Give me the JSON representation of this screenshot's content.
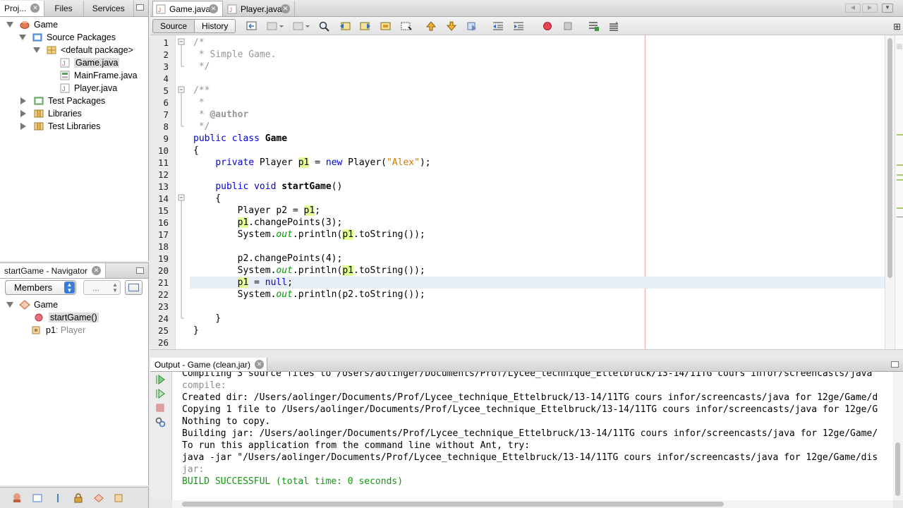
{
  "left_tabs": [
    "Proj...",
    "Files",
    "Services"
  ],
  "project_tree": [
    {
      "label": "Game",
      "depth": 0,
      "expanded": true,
      "icon": "project-icon"
    },
    {
      "label": "Source Packages",
      "depth": 1,
      "expanded": true,
      "icon": "source-packages-icon"
    },
    {
      "label": "<default package>",
      "depth": 2,
      "expanded": true,
      "icon": "package-icon"
    },
    {
      "label": "Game.java",
      "depth": 3,
      "icon": "java-file-icon",
      "selected": true
    },
    {
      "label": "MainFrame.java",
      "depth": 3,
      "icon": "form-file-icon"
    },
    {
      "label": "Player.java",
      "depth": 3,
      "icon": "java-file-icon"
    },
    {
      "label": "Test Packages",
      "depth": 1,
      "expanded": false,
      "icon": "test-packages-icon"
    },
    {
      "label": "Libraries",
      "depth": 1,
      "expanded": false,
      "icon": "libraries-icon"
    },
    {
      "label": "Test Libraries",
      "depth": 1,
      "expanded": false,
      "icon": "test-libraries-icon"
    }
  ],
  "navigator": {
    "title": "startGame - Navigator",
    "filter": "Members",
    "filter2": "...",
    "root": "Game",
    "members": [
      {
        "name": "startGame()",
        "type": "",
        "icon": "method-icon",
        "selected": true
      },
      {
        "name": "p1",
        "type": " : Player",
        "icon": "field-icon"
      }
    ]
  },
  "editor": {
    "tabs": [
      "Game.java",
      "Player.java"
    ],
    "source_label": "Source",
    "history_label": "History",
    "current_line": 21,
    "lines": [
      {
        "n": "1",
        "html": "<span class='cm'>/*</span>"
      },
      {
        "n": "2",
        "html": "<span class='cm'> * Simple Game.</span>"
      },
      {
        "n": "3",
        "html": "<span class='cm'> */</span>"
      },
      {
        "n": "4",
        "html": ""
      },
      {
        "n": "5",
        "html": "<span class='cm'>/**</span>"
      },
      {
        "n": "6",
        "html": "<span class='cm'> *</span>"
      },
      {
        "n": "7",
        "html": "<span class='cm'> * <b>@author</b></span>"
      },
      {
        "n": "8",
        "html": "<span class='cm'> */</span>"
      },
      {
        "n": "9",
        "html": "<span class='kw'>public class</span> <span class='bold'>Game</span>"
      },
      {
        "n": "10",
        "html": "{"
      },
      {
        "n": "11",
        "html": "    <span class='kw'>private</span> Player <span class='hl'>p1</span> = <span class='kw'>new</span> Player(<span class='st'>\"Alex\"</span>);"
      },
      {
        "n": "12",
        "html": ""
      },
      {
        "n": "13",
        "html": "    <span class='kw'>public void</span> <span class='bold'>startGame</span>()"
      },
      {
        "n": "14",
        "html": "    {"
      },
      {
        "n": "15",
        "html": "        Player p2 = <span class='hl'>p1</span>;"
      },
      {
        "n": "16",
        "html": "        <span class='hl'>p1</span>.changePoints(3);"
      },
      {
        "n": "17",
        "html": "        System.<span class='it'>out</span>.println(<span class='hl'>p1</span>.toString());"
      },
      {
        "n": "18",
        "html": ""
      },
      {
        "n": "19",
        "html": "        p2.changePoints(4);"
      },
      {
        "n": "20",
        "html": "        System.<span class='it'>out</span>.println(<span class='hl'>p1</span>.toString());"
      },
      {
        "n": "21",
        "html": "        <span class='hl'>p1</span> = <span class='kw'>null</span>;"
      },
      {
        "n": "22",
        "html": "        System.<span class='it'>out</span>.println(p2.toString());"
      },
      {
        "n": "23",
        "html": ""
      },
      {
        "n": "24",
        "html": "    }"
      },
      {
        "n": "25",
        "html": "}"
      },
      {
        "n": "26",
        "html": ""
      }
    ]
  },
  "output": {
    "title": "Output - Game (clean,jar)",
    "lines": [
      {
        "text": "Compiling 3 source files to /Users/aolinger/Documents/Prof/Lycee_technique_Ettelbruck/13-14/11TG cours infor/screencasts/java",
        "color": "#000"
      },
      {
        "text": "compile:",
        "color": "#8c8c8c"
      },
      {
        "text": "Created dir: /Users/aolinger/Documents/Prof/Lycee_technique_Ettelbruck/13-14/11TG cours infor/screencasts/java for 12ge/Game/d",
        "color": "#000"
      },
      {
        "text": "Copying 1 file to /Users/aolinger/Documents/Prof/Lycee_technique_Ettelbruck/13-14/11TG cours infor/screencasts/java for 12ge/G",
        "color": "#000"
      },
      {
        "text": "Nothing to copy.",
        "color": "#000"
      },
      {
        "text": "Building jar: /Users/aolinger/Documents/Prof/Lycee_technique_Ettelbruck/13-14/11TG cours infor/screencasts/java for 12ge/Game/",
        "color": "#000"
      },
      {
        "text": "To run this application from the command line without Ant, try:",
        "color": "#000"
      },
      {
        "text": "java -jar \"/Users/aolinger/Documents/Prof/Lycee_technique_Ettelbruck/13-14/11TG cours infor/screencasts/java for 12ge/Game/dis",
        "color": "#000"
      },
      {
        "text": "jar:",
        "color": "#8c8c8c"
      },
      {
        "text": "BUILD SUCCESSFUL (total time: 0 seconds)",
        "color": "#129812"
      }
    ]
  },
  "colors": {
    "keyword": "#0000e6",
    "comment": "#969696",
    "string": "#ce7b00",
    "highlight": "#e4ff96",
    "success": "#129812"
  }
}
